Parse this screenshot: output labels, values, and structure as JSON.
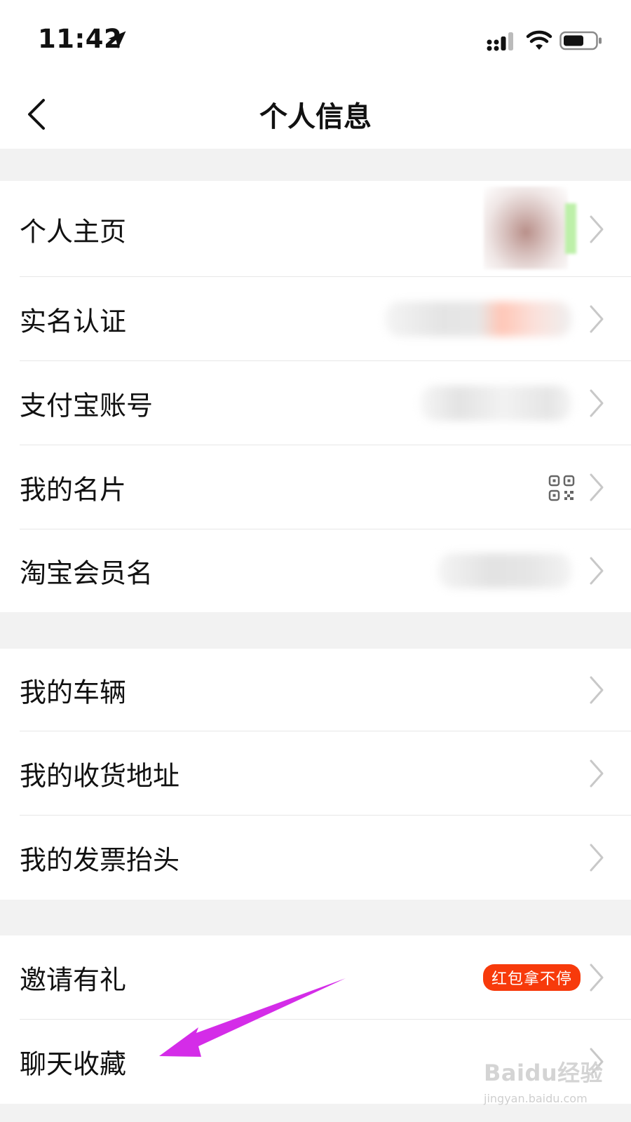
{
  "status_bar": {
    "time": "11:42",
    "icons": [
      "location-arrow-icon",
      "cellular-signal-icon",
      "wifi-icon",
      "battery-icon"
    ]
  },
  "nav": {
    "back_icon": "chevron-left-icon",
    "title": "个人信息"
  },
  "groups": [
    {
      "items": [
        {
          "label": "个人主页",
          "trailing": "avatar-image"
        },
        {
          "label": "实名认证",
          "trailing": "blurred-value"
        },
        {
          "label": "支付宝账号",
          "trailing": "blurred-value"
        },
        {
          "label": "我的名片",
          "trailing": "qr-code-icon"
        },
        {
          "label": "淘宝会员名",
          "trailing": "blurred-value"
        }
      ]
    },
    {
      "items": [
        {
          "label": "我的车辆"
        },
        {
          "label": "我的收货地址"
        },
        {
          "label": "我的发票抬头"
        }
      ]
    },
    {
      "items": [
        {
          "label": "邀请有礼",
          "badge": "红包拿不停"
        },
        {
          "label": "聊天收藏"
        }
      ]
    }
  ],
  "annotation": {
    "icon": "magenta-arrow-icon",
    "color": "#d42ce8"
  },
  "watermark": {
    "logo_text": "Baidu经验",
    "url": "jingyan.baidu.com"
  },
  "colors": {
    "badge": "#f73a0b",
    "background": "#f2f2f2",
    "chevron": "#c8c8c8"
  }
}
